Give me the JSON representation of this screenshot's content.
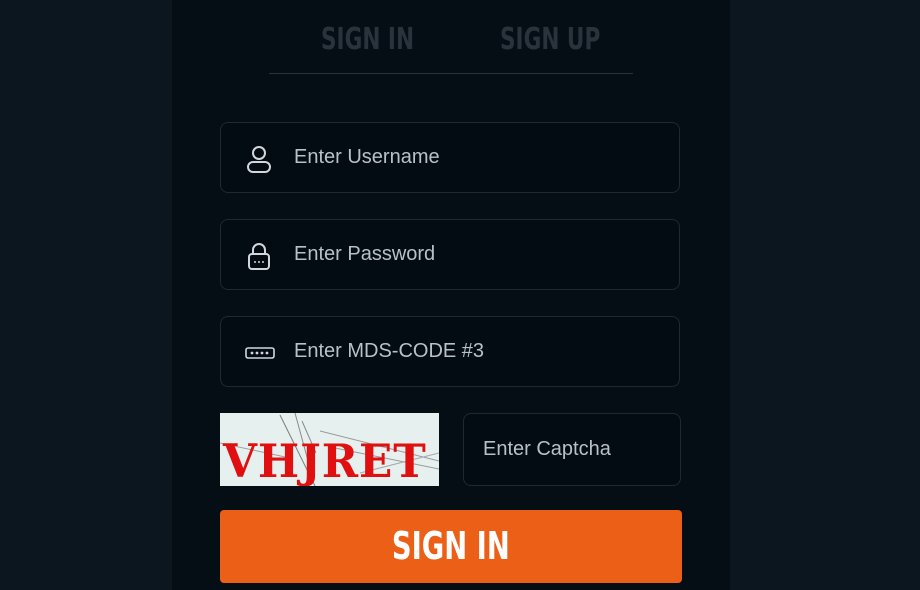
{
  "tabs": {
    "sign_in": "SIGN IN",
    "sign_up": "SIGN UP"
  },
  "form": {
    "username": {
      "placeholder": "Enter Username",
      "icon": "user-icon"
    },
    "password": {
      "placeholder": "Enter Password",
      "icon": "lock-icon"
    },
    "mds_code": {
      "placeholder": "Enter MDS-CODE #3",
      "icon": "keypad-icon"
    },
    "captcha": {
      "image_text": "VHJRET",
      "placeholder": "Enter Captcha"
    },
    "submit_label": "SIGN IN"
  },
  "colors": {
    "page_bg": "#0c161f",
    "panel_bg": "#050d15",
    "accent": "#ec5f16",
    "captcha_text": "#e01010"
  }
}
